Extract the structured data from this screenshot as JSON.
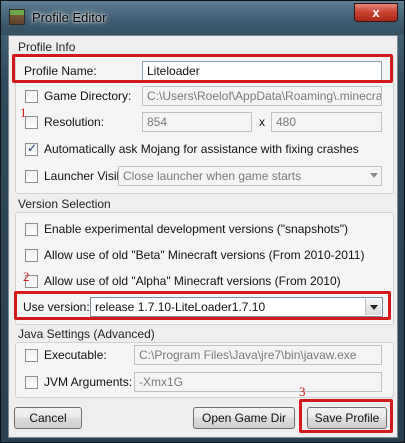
{
  "window": {
    "title": "Profile Editor",
    "close_glyph": "x"
  },
  "profile_info": {
    "title": "Profile Info",
    "profile_name_label": "Profile Name:",
    "profile_name_value": "Liteloader",
    "game_directory_label": "Game Directory:",
    "game_directory_value": "C:\\Users\\Roelof\\AppData\\Roaming\\.minecraft",
    "game_directory_checked": false,
    "resolution_label": "Resolution:",
    "resolution_width": "854",
    "resolution_sep": "x",
    "resolution_height": "480",
    "resolution_checked": false,
    "mojang_assist_label": "Automatically ask Mojang for assistance with fixing crashes",
    "mojang_assist_checked": true,
    "launcher_visibility_label": "Launcher Visibility:",
    "launcher_visibility_value": "Close launcher when game starts",
    "launcher_visibility_checked": false
  },
  "version_selection": {
    "title": "Version Selection",
    "snapshots_label": "Enable experimental development versions (\"snapshots\")",
    "beta_label": "Allow use of old \"Beta\" Minecraft versions (From 2010-2011)",
    "alpha_label": "Allow use of old \"Alpha\" Minecraft versions (From 2010)",
    "use_version_label": "Use version:",
    "use_version_value": "release 1.7.10-LiteLoader1.7.10"
  },
  "java_settings": {
    "title": "Java Settings (Advanced)",
    "executable_label": "Executable:",
    "executable_value": "C:\\Program Files\\Java\\jre7\\bin\\javaw.exe",
    "jvm_args_label": "JVM Arguments:",
    "jvm_args_value": "-Xmx1G"
  },
  "buttons": {
    "cancel": "Cancel",
    "open_game_dir": "Open Game Dir",
    "save_profile": "Save Profile"
  },
  "annotations": {
    "marker_1": "1",
    "marker_2": "2",
    "marker_3": "3",
    "color": "#d21a1a"
  }
}
